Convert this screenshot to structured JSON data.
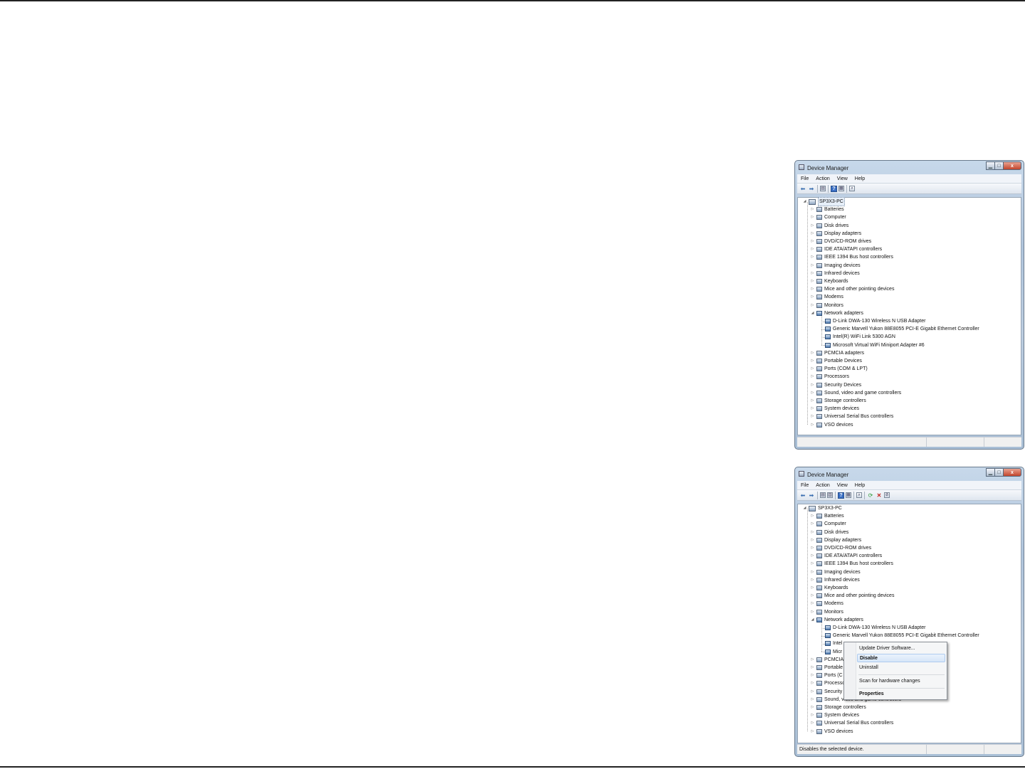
{
  "window_title": "Device Manager",
  "menu": [
    "File",
    "Action",
    "View",
    "Help"
  ],
  "root": "SP3X3-PC",
  "categories": [
    "Batteries",
    "Computer",
    "Disk drives",
    "Display adapters",
    "DVD/CD-ROM drives",
    "IDE ATA/ATAPI controllers",
    "IEEE 1394 Bus host controllers",
    "Imaging devices",
    "Infrared devices",
    "Keyboards",
    "Mice and other pointing devices",
    "Modems",
    "Monitors",
    "Network adapters",
    "PCMCIA adapters",
    "Portable Devices",
    "Ports (COM & LPT)",
    "Processors",
    "Security Devices",
    "Sound, video and game controllers",
    "Storage controllers",
    "System devices",
    "Universal Serial Bus controllers",
    "VSO devices"
  ],
  "network_adapters": [
    "D-Link DWA-130 Wireless N USB Adapter",
    "Generic Marvell Yukon 88E8055 PCI-E Gigabit Ethernet Controller",
    "Intel(R) WiFi Link 5300 AGN",
    "Microsoft Virtual WiFi Miniport Adapter #6"
  ],
  "truncated_second": {
    "intel": "Intel",
    "micro": "Micr",
    "pcmcia": "PCMCIA",
    "portable": "Portable",
    "ports": "Ports (C",
    "processors": "Processo",
    "security": "Security"
  },
  "context_menu": {
    "update": "Update Driver Software...",
    "disable": "Disable",
    "uninstall": "Uninstall",
    "scan": "Scan for hardware changes",
    "properties": "Properties"
  },
  "status_text": "Disables the selected device.",
  "window_buttons": {
    "minimize": "▁",
    "maximize": "□",
    "close": "x"
  }
}
